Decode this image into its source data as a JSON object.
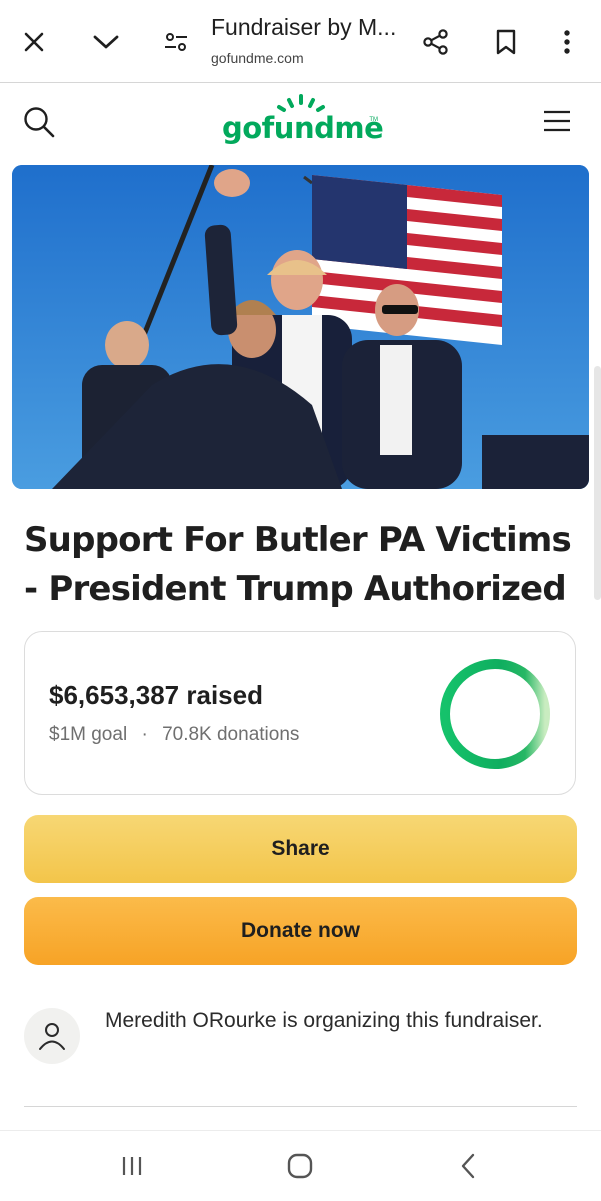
{
  "browser": {
    "title": "Fundraiser by M...",
    "url": "gofundme.com"
  },
  "site": {
    "logo_text": "gofundme",
    "logo_tm": "TM"
  },
  "campaign": {
    "title": "Support For Butler PA Victims - President Trump Authorized",
    "raised_amount": "$6,653,387",
    "raised_suffix": "raised",
    "goal": "$1M goal",
    "separator": "·",
    "donations": "70.8K donations",
    "progress_fraction": 1.0
  },
  "buttons": {
    "share": "Share",
    "donate": "Donate now"
  },
  "organizer": {
    "text": "Meredith ORourke is organizing this fundraiser."
  },
  "colors": {
    "brand_green": "#02a95c",
    "share_yellow": "#f5cf5e",
    "donate_orange": "#f9ad36"
  }
}
